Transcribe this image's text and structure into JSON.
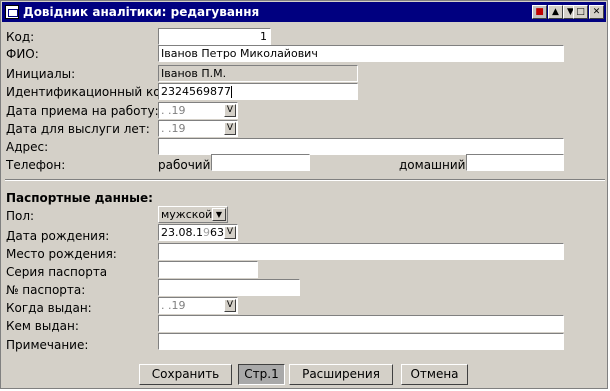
{
  "window": {
    "title": "Довідник аналітики: редагування",
    "controls": [
      "▲",
      "▼",
      "□",
      "✕"
    ]
  },
  "fields": {
    "code": {
      "label": "Код:",
      "value": "1"
    },
    "fio": {
      "label": "ФИО:",
      "value": "Іванов Петро Миколайович"
    },
    "initials": {
      "label": "Инициалы:",
      "value": "Іванов П.М."
    },
    "tax_id": {
      "label": "Идентификационный код:",
      "value": "2324569877"
    },
    "hire_date": {
      "label": "Дата приема на работу:",
      "mask": " .  .19",
      "btn": "V"
    },
    "service_date": {
      "label": "Дата для выслуги лет:",
      "mask": " .  .19",
      "btn": "V"
    },
    "address": {
      "label": "Адрес:",
      "value": ""
    },
    "phone": {
      "label": "Телефон:",
      "work_label": "рабочий:",
      "work_value": "",
      "home_label": "домашний:",
      "home_value": ""
    }
  },
  "passport": {
    "heading": "Паспортные данные:",
    "sex": {
      "label": "Пол:",
      "value": "мужской",
      "arrow": "▼"
    },
    "birth_date": {
      "label": "Дата рождения:",
      "value_main": "23.08.1",
      "value_grey": "9",
      "value_tail": "63",
      "btn": "V"
    },
    "birth_place": {
      "label": "Место рождения:",
      "value": ""
    },
    "series": {
      "label": "Серия паспорта",
      "value": ""
    },
    "number": {
      "label": "№ паспорта:",
      "value": ""
    },
    "issue_date": {
      "label": "Когда выдан:",
      "mask": " .  .19",
      "btn": "V"
    },
    "issued_by": {
      "label": "Кем выдан:",
      "value": ""
    },
    "note": {
      "label": "Примечание:",
      "value": ""
    }
  },
  "buttons": {
    "save": "Сохранить",
    "page": "Стр.1",
    "extensions": "Расширения",
    "cancel": "Отмена"
  }
}
